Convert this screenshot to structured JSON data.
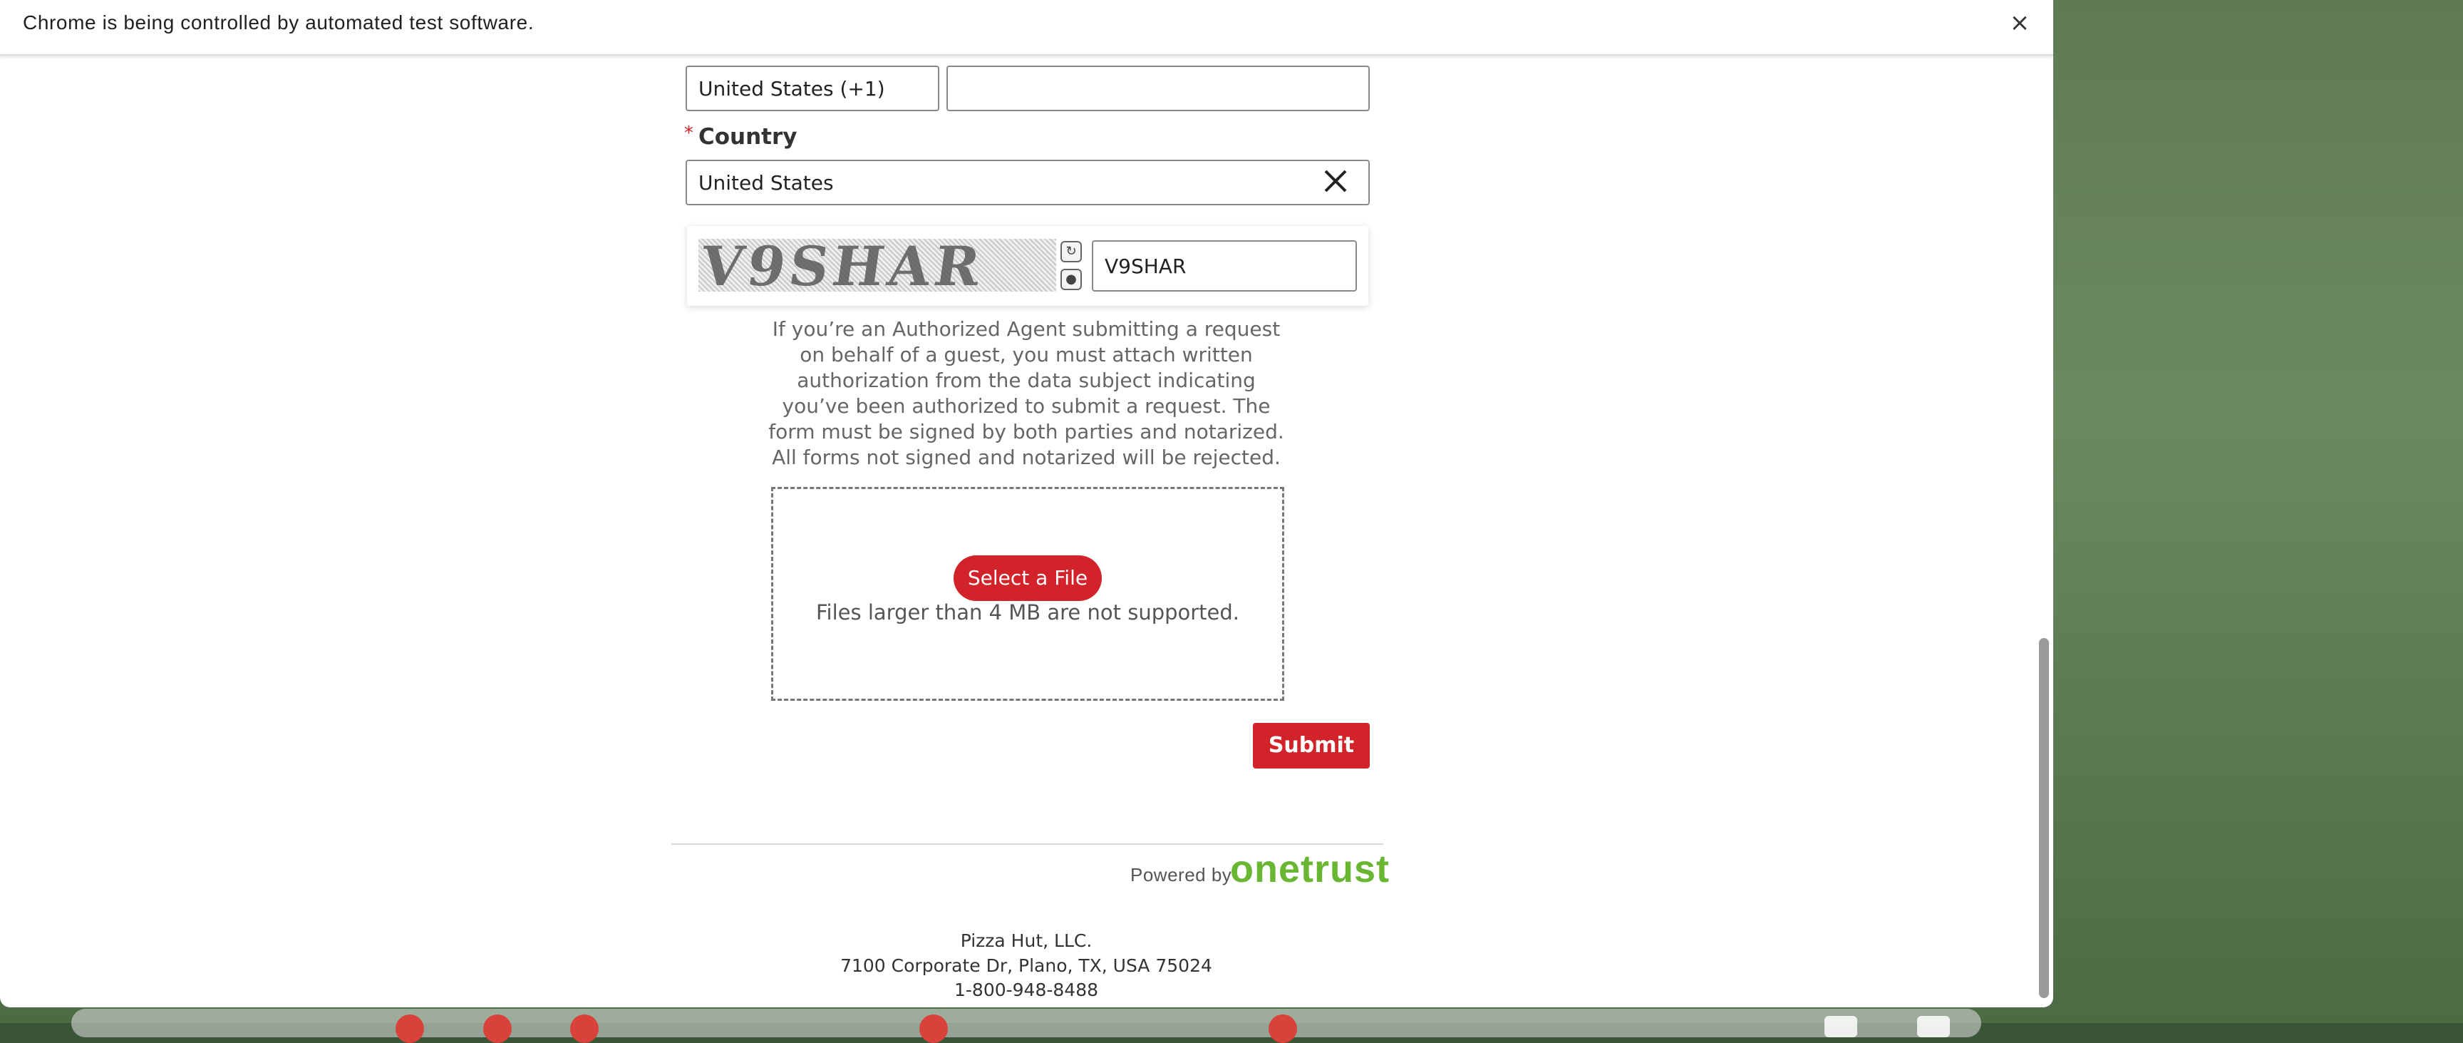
{
  "infobar": {
    "message": "Chrome is being controlled by automated test software.",
    "close_glyph": "×"
  },
  "form": {
    "phone_country_code": "United States (+1)",
    "phone_number": "",
    "country_label": "Country",
    "required_marker": "*",
    "country_value": "United States",
    "captcha_image_text": "V9SHAR",
    "captcha_answer": "V9SHAR",
    "authorized_agent_notice": "If you’re an Authorized Agent submitting a request on behalf of a guest, you must attach written authorization from the data subject indicating you’ve been authorized to submit a request. The form must be signed by both parties and notarized. All forms not signed and notarized will be rejected.",
    "select_file_label": "Select a File",
    "file_size_note": "Files larger than 4 MB are not supported.",
    "submit_label": "Submit"
  },
  "branding": {
    "powered_by": "Powered by",
    "brand_name": "onetrust",
    "brand_color": "#68b631"
  },
  "footer": {
    "company": "Pizza Hut, LLC.",
    "address": "7100 Corporate Dr, Plano, TX, USA 75024",
    "phone": "1-800-948-8488"
  },
  "icons": {
    "clear": "close-icon",
    "captcha_refresh": "refresh-icon",
    "captcha_audio": "audio-icon"
  },
  "colors": {
    "accent_red": "#d2232a"
  }
}
